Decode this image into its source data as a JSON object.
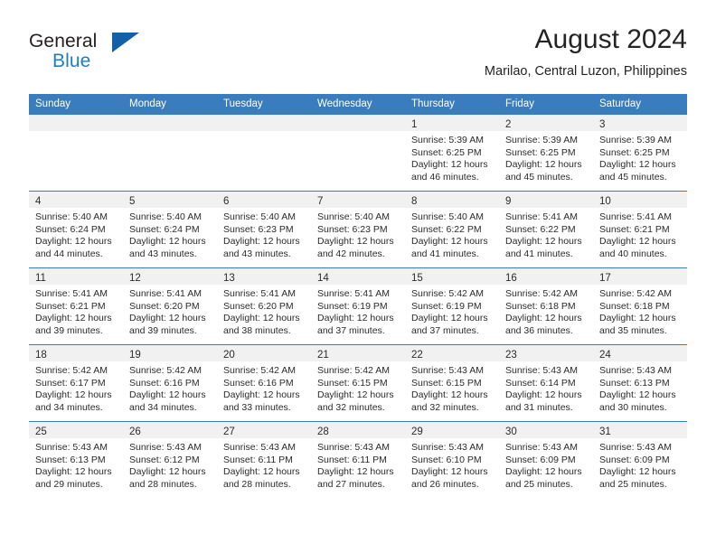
{
  "brand": {
    "name_top": "General",
    "name_bottom": "Blue",
    "logo_icon": "triangle-logo-icon"
  },
  "header": {
    "month_title": "August 2024",
    "location": "Marilao, Central Luzon, Philippines"
  },
  "colors": {
    "header_blue": "#3a7dbf",
    "brand_blue": "#1c7fc4",
    "logo_blue": "#1260a8",
    "daynum_band": "#f1f1f1",
    "text": "#2b2b2b"
  },
  "weekday_headers": [
    "Sunday",
    "Monday",
    "Tuesday",
    "Wednesday",
    "Thursday",
    "Friday",
    "Saturday"
  ],
  "weeks": [
    [
      {
        "day": "",
        "lines": []
      },
      {
        "day": "",
        "lines": []
      },
      {
        "day": "",
        "lines": []
      },
      {
        "day": "",
        "lines": []
      },
      {
        "day": "1",
        "lines": [
          "Sunrise: 5:39 AM",
          "Sunset: 6:25 PM",
          "Daylight: 12 hours",
          "and 46 minutes."
        ]
      },
      {
        "day": "2",
        "lines": [
          "Sunrise: 5:39 AM",
          "Sunset: 6:25 PM",
          "Daylight: 12 hours",
          "and 45 minutes."
        ]
      },
      {
        "day": "3",
        "lines": [
          "Sunrise: 5:39 AM",
          "Sunset: 6:25 PM",
          "Daylight: 12 hours",
          "and 45 minutes."
        ]
      }
    ],
    [
      {
        "day": "4",
        "lines": [
          "Sunrise: 5:40 AM",
          "Sunset: 6:24 PM",
          "Daylight: 12 hours",
          "and 44 minutes."
        ]
      },
      {
        "day": "5",
        "lines": [
          "Sunrise: 5:40 AM",
          "Sunset: 6:24 PM",
          "Daylight: 12 hours",
          "and 43 minutes."
        ]
      },
      {
        "day": "6",
        "lines": [
          "Sunrise: 5:40 AM",
          "Sunset: 6:23 PM",
          "Daylight: 12 hours",
          "and 43 minutes."
        ]
      },
      {
        "day": "7",
        "lines": [
          "Sunrise: 5:40 AM",
          "Sunset: 6:23 PM",
          "Daylight: 12 hours",
          "and 42 minutes."
        ]
      },
      {
        "day": "8",
        "lines": [
          "Sunrise: 5:40 AM",
          "Sunset: 6:22 PM",
          "Daylight: 12 hours",
          "and 41 minutes."
        ]
      },
      {
        "day": "9",
        "lines": [
          "Sunrise: 5:41 AM",
          "Sunset: 6:22 PM",
          "Daylight: 12 hours",
          "and 41 minutes."
        ]
      },
      {
        "day": "10",
        "lines": [
          "Sunrise: 5:41 AM",
          "Sunset: 6:21 PM",
          "Daylight: 12 hours",
          "and 40 minutes."
        ]
      }
    ],
    [
      {
        "day": "11",
        "lines": [
          "Sunrise: 5:41 AM",
          "Sunset: 6:21 PM",
          "Daylight: 12 hours",
          "and 39 minutes."
        ]
      },
      {
        "day": "12",
        "lines": [
          "Sunrise: 5:41 AM",
          "Sunset: 6:20 PM",
          "Daylight: 12 hours",
          "and 39 minutes."
        ]
      },
      {
        "day": "13",
        "lines": [
          "Sunrise: 5:41 AM",
          "Sunset: 6:20 PM",
          "Daylight: 12 hours",
          "and 38 minutes."
        ]
      },
      {
        "day": "14",
        "lines": [
          "Sunrise: 5:41 AM",
          "Sunset: 6:19 PM",
          "Daylight: 12 hours",
          "and 37 minutes."
        ]
      },
      {
        "day": "15",
        "lines": [
          "Sunrise: 5:42 AM",
          "Sunset: 6:19 PM",
          "Daylight: 12 hours",
          "and 37 minutes."
        ]
      },
      {
        "day": "16",
        "lines": [
          "Sunrise: 5:42 AM",
          "Sunset: 6:18 PM",
          "Daylight: 12 hours",
          "and 36 minutes."
        ]
      },
      {
        "day": "17",
        "lines": [
          "Sunrise: 5:42 AM",
          "Sunset: 6:18 PM",
          "Daylight: 12 hours",
          "and 35 minutes."
        ]
      }
    ],
    [
      {
        "day": "18",
        "lines": [
          "Sunrise: 5:42 AM",
          "Sunset: 6:17 PM",
          "Daylight: 12 hours",
          "and 34 minutes."
        ]
      },
      {
        "day": "19",
        "lines": [
          "Sunrise: 5:42 AM",
          "Sunset: 6:16 PM",
          "Daylight: 12 hours",
          "and 34 minutes."
        ]
      },
      {
        "day": "20",
        "lines": [
          "Sunrise: 5:42 AM",
          "Sunset: 6:16 PM",
          "Daylight: 12 hours",
          "and 33 minutes."
        ]
      },
      {
        "day": "21",
        "lines": [
          "Sunrise: 5:42 AM",
          "Sunset: 6:15 PM",
          "Daylight: 12 hours",
          "and 32 minutes."
        ]
      },
      {
        "day": "22",
        "lines": [
          "Sunrise: 5:43 AM",
          "Sunset: 6:15 PM",
          "Daylight: 12 hours",
          "and 32 minutes."
        ]
      },
      {
        "day": "23",
        "lines": [
          "Sunrise: 5:43 AM",
          "Sunset: 6:14 PM",
          "Daylight: 12 hours",
          "and 31 minutes."
        ]
      },
      {
        "day": "24",
        "lines": [
          "Sunrise: 5:43 AM",
          "Sunset: 6:13 PM",
          "Daylight: 12 hours",
          "and 30 minutes."
        ]
      }
    ],
    [
      {
        "day": "25",
        "lines": [
          "Sunrise: 5:43 AM",
          "Sunset: 6:13 PM",
          "Daylight: 12 hours",
          "and 29 minutes."
        ]
      },
      {
        "day": "26",
        "lines": [
          "Sunrise: 5:43 AM",
          "Sunset: 6:12 PM",
          "Daylight: 12 hours",
          "and 28 minutes."
        ]
      },
      {
        "day": "27",
        "lines": [
          "Sunrise: 5:43 AM",
          "Sunset: 6:11 PM",
          "Daylight: 12 hours",
          "and 28 minutes."
        ]
      },
      {
        "day": "28",
        "lines": [
          "Sunrise: 5:43 AM",
          "Sunset: 6:11 PM",
          "Daylight: 12 hours",
          "and 27 minutes."
        ]
      },
      {
        "day": "29",
        "lines": [
          "Sunrise: 5:43 AM",
          "Sunset: 6:10 PM",
          "Daylight: 12 hours",
          "and 26 minutes."
        ]
      },
      {
        "day": "30",
        "lines": [
          "Sunrise: 5:43 AM",
          "Sunset: 6:09 PM",
          "Daylight: 12 hours",
          "and 25 minutes."
        ]
      },
      {
        "day": "31",
        "lines": [
          "Sunrise: 5:43 AM",
          "Sunset: 6:09 PM",
          "Daylight: 12 hours",
          "and 25 minutes."
        ]
      }
    ]
  ]
}
